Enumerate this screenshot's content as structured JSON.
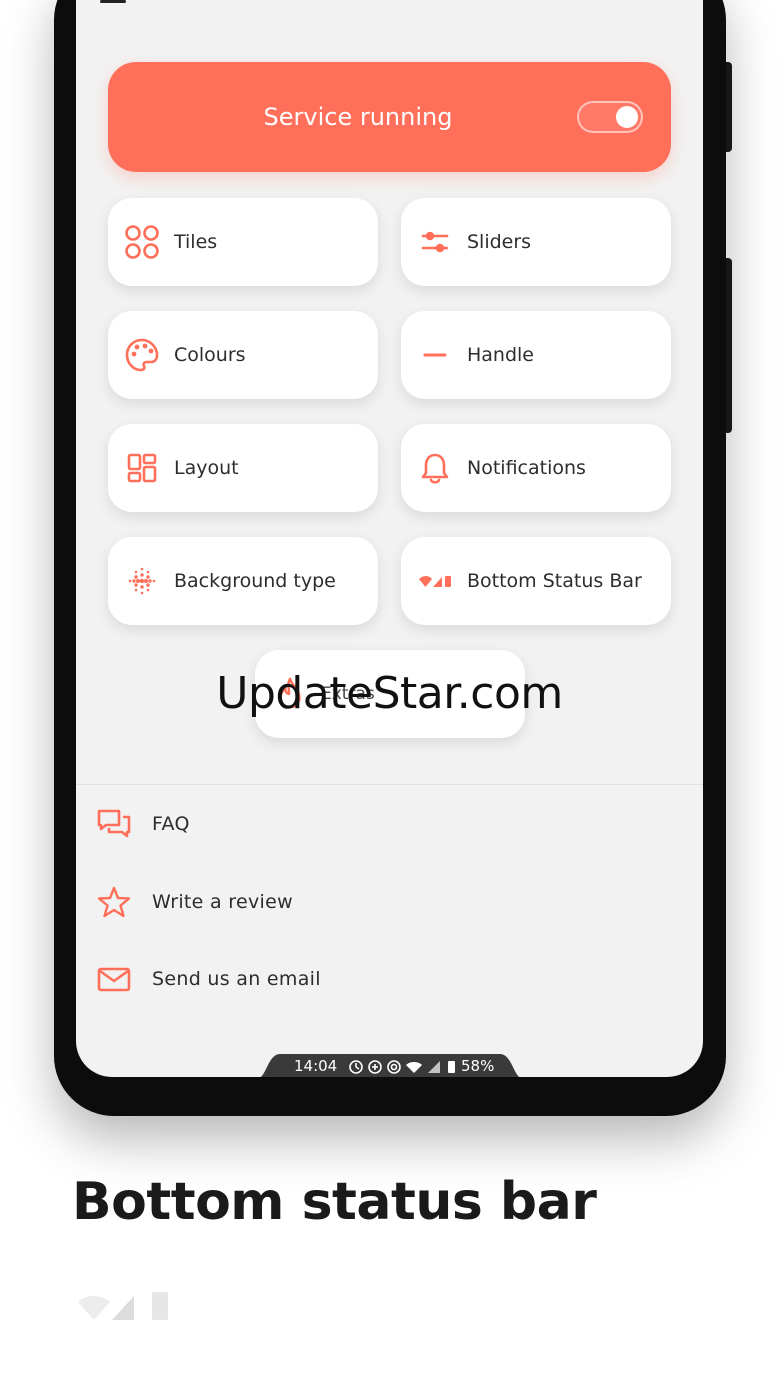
{
  "service": {
    "label": "Service running",
    "toggle_on": true
  },
  "tiles": [
    {
      "label": "Tiles",
      "icon": "tiles-icon"
    },
    {
      "label": "Sliders",
      "icon": "sliders-icon"
    },
    {
      "label": "Colours",
      "icon": "palette-icon"
    },
    {
      "label": "Handle",
      "icon": "handle-icon"
    },
    {
      "label": "Layout",
      "icon": "layout-icon"
    },
    {
      "label": "Notifications",
      "icon": "bell-icon"
    },
    {
      "label": "Background type",
      "icon": "dots-grid-icon"
    },
    {
      "label": "Bottom Status Bar",
      "icon": "status-bar-icon"
    }
  ],
  "extras": {
    "label": "Extras",
    "icon": "flame-icon"
  },
  "watermark": "UpdateStar.com",
  "links": [
    {
      "label": "FAQ",
      "icon": "chat-bubbles-icon"
    },
    {
      "label": "Write a review",
      "icon": "star-icon"
    },
    {
      "label": "Send us an email",
      "icon": "mail-icon"
    }
  ],
  "status_bar": {
    "time": "14:04",
    "battery": "58%"
  },
  "caption": "Bottom status bar",
  "colors": {
    "accent": "#ff6f59",
    "background": "#f2f2f2",
    "card": "#ffffff",
    "text": "#2d2d2d"
  }
}
